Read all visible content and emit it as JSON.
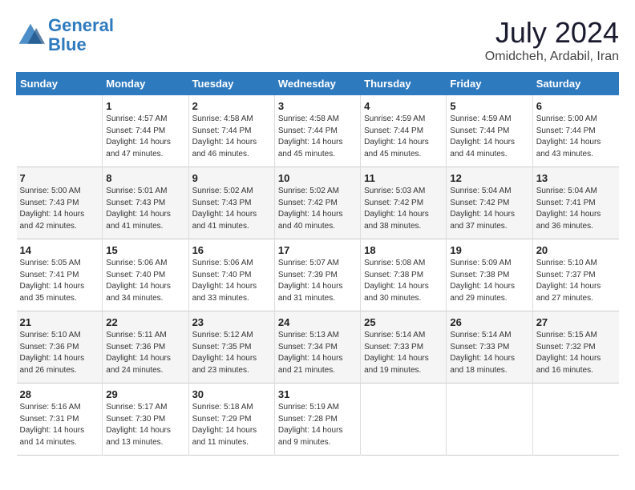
{
  "header": {
    "logo_line1": "General",
    "logo_line2": "Blue",
    "month": "July 2024",
    "location": "Omidcheh, Ardabil, Iran"
  },
  "weekdays": [
    "Sunday",
    "Monday",
    "Tuesday",
    "Wednesday",
    "Thursday",
    "Friday",
    "Saturday"
  ],
  "rows": [
    [
      {
        "day": "",
        "info": ""
      },
      {
        "day": "1",
        "info": "Sunrise: 4:57 AM\nSunset: 7:44 PM\nDaylight: 14 hours\nand 47 minutes."
      },
      {
        "day": "2",
        "info": "Sunrise: 4:58 AM\nSunset: 7:44 PM\nDaylight: 14 hours\nand 46 minutes."
      },
      {
        "day": "3",
        "info": "Sunrise: 4:58 AM\nSunset: 7:44 PM\nDaylight: 14 hours\nand 45 minutes."
      },
      {
        "day": "4",
        "info": "Sunrise: 4:59 AM\nSunset: 7:44 PM\nDaylight: 14 hours\nand 45 minutes."
      },
      {
        "day": "5",
        "info": "Sunrise: 4:59 AM\nSunset: 7:44 PM\nDaylight: 14 hours\nand 44 minutes."
      },
      {
        "day": "6",
        "info": "Sunrise: 5:00 AM\nSunset: 7:44 PM\nDaylight: 14 hours\nand 43 minutes."
      }
    ],
    [
      {
        "day": "7",
        "info": "Sunrise: 5:00 AM\nSunset: 7:43 PM\nDaylight: 14 hours\nand 42 minutes."
      },
      {
        "day": "8",
        "info": "Sunrise: 5:01 AM\nSunset: 7:43 PM\nDaylight: 14 hours\nand 41 minutes."
      },
      {
        "day": "9",
        "info": "Sunrise: 5:02 AM\nSunset: 7:43 PM\nDaylight: 14 hours\nand 41 minutes."
      },
      {
        "day": "10",
        "info": "Sunrise: 5:02 AM\nSunset: 7:42 PM\nDaylight: 14 hours\nand 40 minutes."
      },
      {
        "day": "11",
        "info": "Sunrise: 5:03 AM\nSunset: 7:42 PM\nDaylight: 14 hours\nand 38 minutes."
      },
      {
        "day": "12",
        "info": "Sunrise: 5:04 AM\nSunset: 7:42 PM\nDaylight: 14 hours\nand 37 minutes."
      },
      {
        "day": "13",
        "info": "Sunrise: 5:04 AM\nSunset: 7:41 PM\nDaylight: 14 hours\nand 36 minutes."
      }
    ],
    [
      {
        "day": "14",
        "info": "Sunrise: 5:05 AM\nSunset: 7:41 PM\nDaylight: 14 hours\nand 35 minutes."
      },
      {
        "day": "15",
        "info": "Sunrise: 5:06 AM\nSunset: 7:40 PM\nDaylight: 14 hours\nand 34 minutes."
      },
      {
        "day": "16",
        "info": "Sunrise: 5:06 AM\nSunset: 7:40 PM\nDaylight: 14 hours\nand 33 minutes."
      },
      {
        "day": "17",
        "info": "Sunrise: 5:07 AM\nSunset: 7:39 PM\nDaylight: 14 hours\nand 31 minutes."
      },
      {
        "day": "18",
        "info": "Sunrise: 5:08 AM\nSunset: 7:38 PM\nDaylight: 14 hours\nand 30 minutes."
      },
      {
        "day": "19",
        "info": "Sunrise: 5:09 AM\nSunset: 7:38 PM\nDaylight: 14 hours\nand 29 minutes."
      },
      {
        "day": "20",
        "info": "Sunrise: 5:10 AM\nSunset: 7:37 PM\nDaylight: 14 hours\nand 27 minutes."
      }
    ],
    [
      {
        "day": "21",
        "info": "Sunrise: 5:10 AM\nSunset: 7:36 PM\nDaylight: 14 hours\nand 26 minutes."
      },
      {
        "day": "22",
        "info": "Sunrise: 5:11 AM\nSunset: 7:36 PM\nDaylight: 14 hours\nand 24 minutes."
      },
      {
        "day": "23",
        "info": "Sunrise: 5:12 AM\nSunset: 7:35 PM\nDaylight: 14 hours\nand 23 minutes."
      },
      {
        "day": "24",
        "info": "Sunrise: 5:13 AM\nSunset: 7:34 PM\nDaylight: 14 hours\nand 21 minutes."
      },
      {
        "day": "25",
        "info": "Sunrise: 5:14 AM\nSunset: 7:33 PM\nDaylight: 14 hours\nand 19 minutes."
      },
      {
        "day": "26",
        "info": "Sunrise: 5:14 AM\nSunset: 7:33 PM\nDaylight: 14 hours\nand 18 minutes."
      },
      {
        "day": "27",
        "info": "Sunrise: 5:15 AM\nSunset: 7:32 PM\nDaylight: 14 hours\nand 16 minutes."
      }
    ],
    [
      {
        "day": "28",
        "info": "Sunrise: 5:16 AM\nSunset: 7:31 PM\nDaylight: 14 hours\nand 14 minutes."
      },
      {
        "day": "29",
        "info": "Sunrise: 5:17 AM\nSunset: 7:30 PM\nDaylight: 14 hours\nand 13 minutes."
      },
      {
        "day": "30",
        "info": "Sunrise: 5:18 AM\nSunset: 7:29 PM\nDaylight: 14 hours\nand 11 minutes."
      },
      {
        "day": "31",
        "info": "Sunrise: 5:19 AM\nSunset: 7:28 PM\nDaylight: 14 hours\nand 9 minutes."
      },
      {
        "day": "",
        "info": ""
      },
      {
        "day": "",
        "info": ""
      },
      {
        "day": "",
        "info": ""
      }
    ]
  ]
}
